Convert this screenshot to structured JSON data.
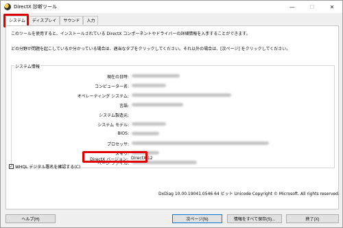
{
  "window": {
    "title": "DirectX 診断ツール",
    "minimize_glyph": "—",
    "maximize_glyph": "☐",
    "close_glyph": "✕",
    "icon": "directx-icon"
  },
  "tabs": [
    {
      "label": "システム",
      "active": true
    },
    {
      "label": "ディスプレイ",
      "active": false
    },
    {
      "label": "サウンド",
      "active": false
    },
    {
      "label": "入力",
      "active": false
    }
  ],
  "intro": {
    "line1": "このツールを使用すると、インストールされている DirectX コンポーネントやドライバーの詳細情報を入手することができます。",
    "line2": "どの分野が問題を起こしているか分かっている場合は、適当なタブをクリックしてください。それ以外の場合は、[次ページ] をクリックしてください。"
  },
  "system_info": {
    "group_title": "システム情報",
    "rows": [
      {
        "label": "現在の日時:",
        "value": ""
      },
      {
        "label": "コンピューター名:",
        "value": ""
      },
      {
        "label": "オペレーティング システム:",
        "value": ""
      },
      {
        "label": "言語:",
        "value": ""
      },
      {
        "label": "システム製造元:",
        "value": ""
      },
      {
        "label": "システム モデル:",
        "value": ""
      },
      {
        "label": "BIOS:",
        "value": ""
      },
      {
        "label": "プロセッサ:",
        "value": ""
      },
      {
        "label": "メモリ:",
        "value": ""
      },
      {
        "label": "ページ ファイル:",
        "value": ""
      },
      {
        "label": "DirectX バージョン:",
        "value": "DirectX 12"
      }
    ]
  },
  "whql": {
    "label": "WHQL デジタル署名を確認する(C)",
    "checked": true,
    "check_glyph": "✓"
  },
  "footer": "DxDiag 10.00.19041.0546 64 ビット Unicode  Copyright © Microsoft. All rights reserved.",
  "buttons": {
    "help": "ヘルプ(H)",
    "next": "次ページ(N)",
    "save_all": "情報をすべて保存(S)...",
    "exit": "終了(X)"
  },
  "highlight_color": "#e00000"
}
